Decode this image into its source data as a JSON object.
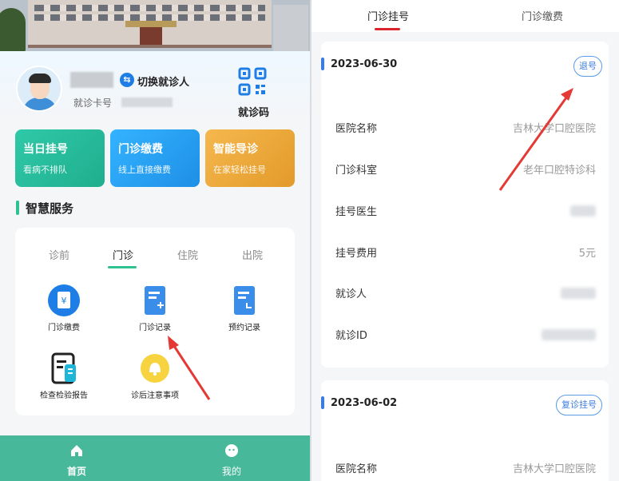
{
  "left": {
    "user": {
      "switch_label": "切换就诊人",
      "card_no_label": "就诊卡号",
      "qr_label": "就诊码"
    },
    "quick_actions": [
      {
        "title": "当日挂号",
        "subtitle": "看病不排队"
      },
      {
        "title": "门诊缴费",
        "subtitle": "线上直接缴费"
      },
      {
        "title": "智能导诊",
        "subtitle": "在家轻松挂号"
      }
    ],
    "section_title": "智慧服务",
    "service_tabs": [
      "诊前",
      "门诊",
      "住院",
      "出院"
    ],
    "active_service_tab": "门诊",
    "services": [
      {
        "label": "门诊缴费",
        "icon": "payment-icon"
      },
      {
        "label": "门诊记录",
        "icon": "record-icon"
      },
      {
        "label": "预约记录",
        "icon": "appointment-icon"
      },
      {
        "label": "检查检验报告",
        "icon": "report-icon"
      },
      {
        "label": "诊后注意事项",
        "icon": "bell-icon"
      }
    ],
    "tabbar": [
      {
        "label": "首页",
        "icon": "home-icon",
        "active": true
      },
      {
        "label": "我的",
        "icon": "profile-icon",
        "active": false
      }
    ],
    "colors": {
      "accent": "#47b99a",
      "quick1": "#1fae8e",
      "quick2": "#1e8fe6",
      "quick3": "#e39a2a"
    }
  },
  "right": {
    "tabs": [
      "门诊挂号",
      "门诊缴费"
    ],
    "active_tab": "门诊挂号",
    "records": [
      {
        "date": "2023-06-30",
        "action": "退号",
        "fields": [
          {
            "label": "医院名称",
            "value": "吉林大学口腔医院"
          },
          {
            "label": "门诊科室",
            "value": "老年口腔特诊科"
          },
          {
            "label": "挂号医生",
            "value": ""
          },
          {
            "label": "挂号费用",
            "value": "5元"
          },
          {
            "label": "就诊人",
            "value": ""
          },
          {
            "label": "就诊ID",
            "value": ""
          }
        ]
      },
      {
        "date": "2023-06-02",
        "action": "复诊挂号",
        "fields": [
          {
            "label": "医院名称",
            "value": "吉林大学口腔医院"
          }
        ]
      }
    ],
    "colors": {
      "tab_underline": "#d9232d",
      "record_accent": "#3a7be0"
    }
  }
}
